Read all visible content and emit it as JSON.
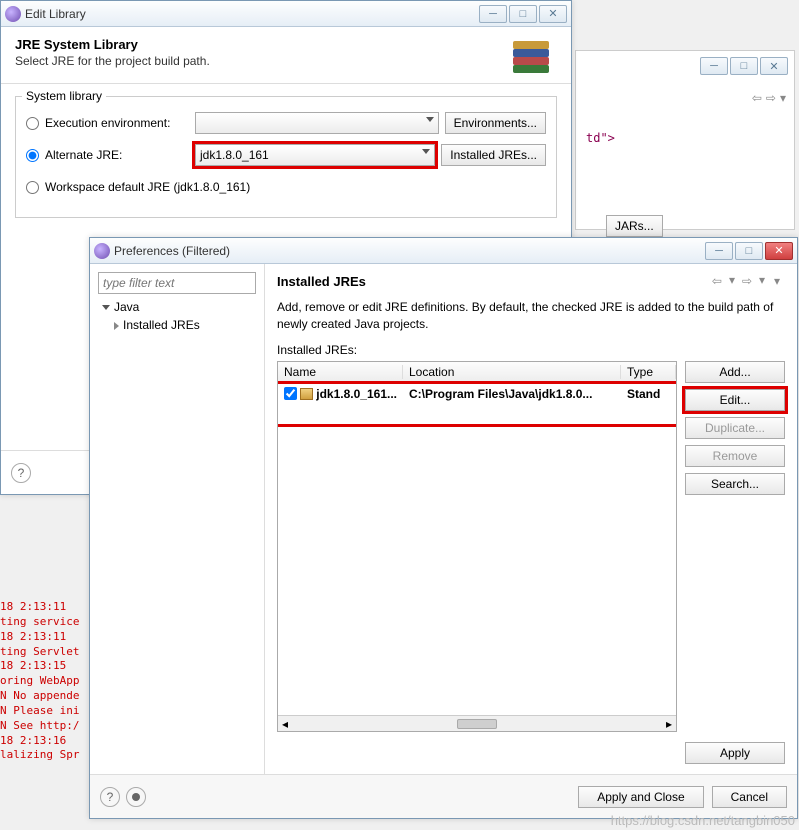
{
  "editlib": {
    "title": "Edit Library",
    "heading": "JRE System Library",
    "subheading": "Select JRE for the project build path.",
    "group_legend": "System library",
    "exec_env_label": "Execution environment:",
    "alt_jre_label": "Alternate JRE:",
    "alt_jre_value": "jdk1.8.0_161",
    "workspace_label": "Workspace default JRE (jdk1.8.0_161)",
    "btn_env": "Environments...",
    "btn_installed": "Installed JREs..."
  },
  "prefs": {
    "title": "Preferences (Filtered)",
    "filter_placeholder": "type filter text",
    "tree_root": "Java",
    "tree_child": "Installed JREs",
    "heading": "Installed JREs",
    "desc": "Add, remove or edit JRE definitions. By default, the checked JRE is added to the build path of newly created Java projects.",
    "table_label": "Installed JREs:",
    "cols": {
      "name": "Name",
      "loc": "Location",
      "typ": "Type"
    },
    "row": {
      "name": "jdk1.8.0_161...",
      "loc": "C:\\Program Files\\Java\\jdk1.8.0...",
      "typ": "Stand"
    },
    "btns": {
      "add": "Add...",
      "edit": "Edit...",
      "dup": "Duplicate...",
      "rem": "Remove",
      "search": "Search...",
      "apply": "Apply"
    },
    "footer": {
      "apply_close": "Apply and Close",
      "cancel": "Cancel"
    }
  },
  "bg": {
    "code": "td\">",
    "jars_btn": "JARs..."
  },
  "console_text": "18 2:13:11 \nting service\n18 2:13:11 \nting Servlet\n18 2:13:15 \noring WebApp\nN No appende\nN Please ini\nN See http:/\n18 2:13:16 \nlalizing Spr",
  "watermark": "https://blog.csdn.net/tangbin050"
}
